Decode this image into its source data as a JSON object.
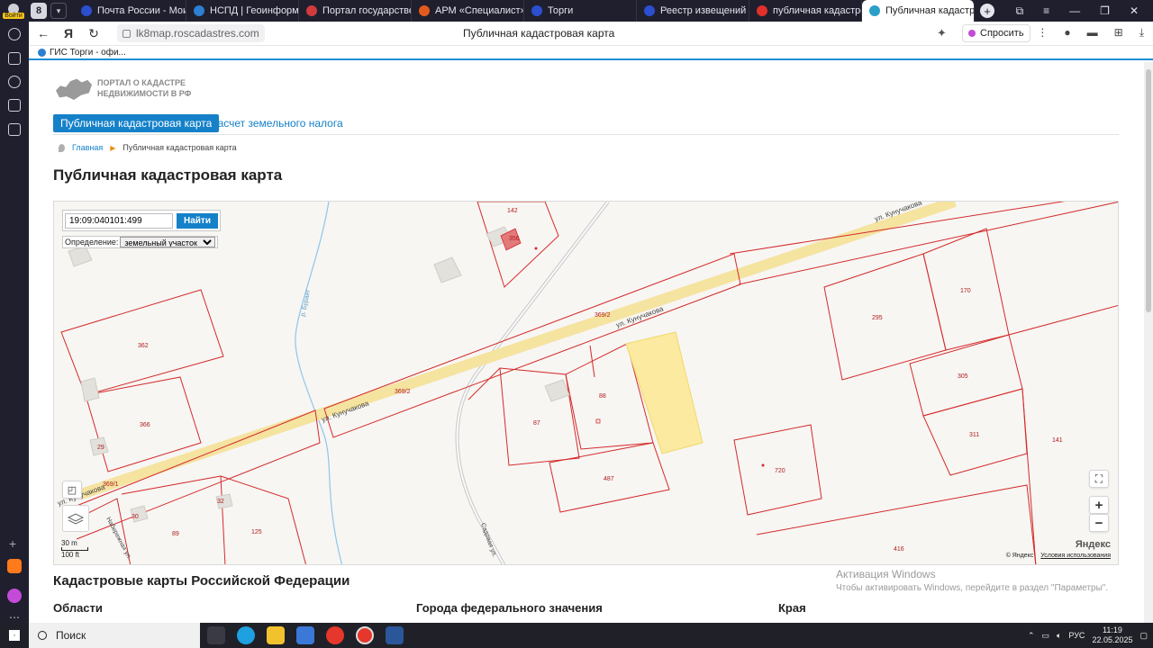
{
  "browser": {
    "profile_badge": "Войти",
    "tabs": [
      {
        "label": "Почта России - Мои от",
        "color": "#2c4fd1"
      },
      {
        "label": "НСПД | Геоинформаци",
        "color": "#2c7fd1"
      },
      {
        "label": "Портал государственн",
        "color": "#d13b3b"
      },
      {
        "label": "АРМ «Специалист»",
        "color": "#e35a1f"
      },
      {
        "label": "Торги",
        "color": "#2c4fd1"
      },
      {
        "label": "Реестр извещений",
        "color": "#2c4fd1"
      },
      {
        "label": "публичная кадастрова",
        "color": "#e0312b"
      },
      {
        "label": "Публичная кадастрова",
        "color": "#2aa0c9"
      }
    ],
    "url": "lk8map.roscadastres.com",
    "page_title": "Публичная кадастровая карта",
    "ask_label": "Спросить",
    "bookmark": "ГИС Торги - офи..."
  },
  "site": {
    "logo_line1": "ПОРТАЛ О КАДАСТРЕ",
    "logo_line2": "НЕДВИЖИМОСТИ В РФ",
    "tab_active": "Публичная кадастровая карта",
    "tab_link": "Расчет земельного налога",
    "breadcrumb_home": "Главная",
    "breadcrumb_current": "Публичная кадастровая карта",
    "heading": "Публичная кадастровая карта",
    "section_heading": "Кадастровые карты Российской Федерации",
    "col1": "Области",
    "col2": "Города федерального значения",
    "col3": "Края"
  },
  "map": {
    "search_value": "19:09:040101:499",
    "search_button": "Найти",
    "definition_label": "Определение:",
    "definition_value": "земельный участок",
    "zoom_in": "+",
    "zoom_out": "−",
    "scale_m": "30 m",
    "scale_ft": "100 ft",
    "copyright": "© Яндекс",
    "terms": "Условия использования",
    "yandex": "Яндекс",
    "labels": {
      "p142": "142",
      "p356": "356",
      "p362": "362",
      "p366": "366",
      "p29": "29",
      "p369_2a": "369/2",
      "p369_2b": "369/2",
      "p369_1": "369/1",
      "p88": "88",
      "p87": "87",
      "p487": "487",
      "p295": "295",
      "p170": "170",
      "p305": "305",
      "p311": "311",
      "p141": "141",
      "p720": "720",
      "p416": "416",
      "p32": "32",
      "p30": "30",
      "p89": "89",
      "p125": "125",
      "street1": "ул. Кунучакова",
      "street2": "ул. Кунучакова",
      "street3": "ул. Кунучакова",
      "street4": "ул. Кунучакова",
      "river": "р. Бураят",
      "sadovaya": "Садовая ул.",
      "naberezhnaya": "Набережная ул."
    }
  },
  "windows": {
    "activation_title": "Активация Windows",
    "activation_text": "Чтобы активировать Windows, перейдите в раздел \"Параметры\".",
    "search": "Поиск",
    "lang": "РУС",
    "time": "11:19",
    "date": "22.05.2025"
  }
}
